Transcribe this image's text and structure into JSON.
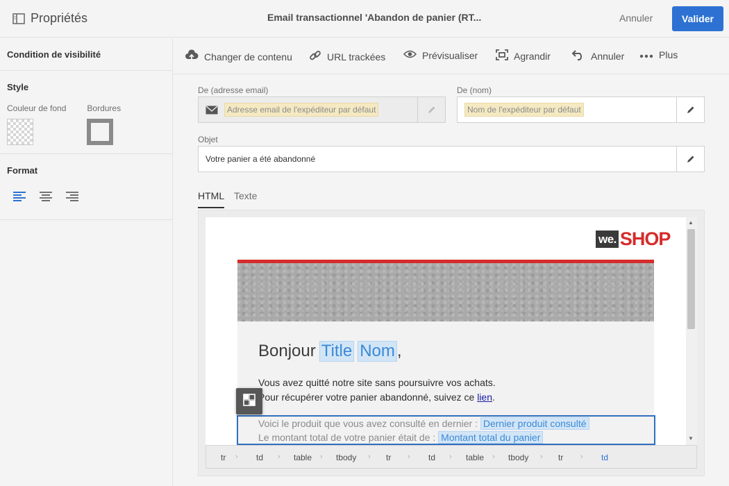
{
  "topbar": {
    "panel_title": "Propriétés",
    "document_title": "Email transactionnel 'Abandon de panier (RT...",
    "cancel_label": "Annuler",
    "validate_label": "Valider"
  },
  "left_panel": {
    "visibility_title": "Condition de visibilité",
    "style_title": "Style",
    "bg_color_label": "Couleur de fond",
    "borders_label": "Bordures",
    "format_title": "Format",
    "format_icons": [
      "align-left-icon",
      "align-center-icon",
      "align-right-icon"
    ]
  },
  "toolbar": {
    "items": [
      {
        "label": "Changer de contenu",
        "icon": "cloud-upload-icon"
      },
      {
        "label": "URL trackées",
        "icon": "link-icon"
      },
      {
        "label": "Prévisualiser",
        "icon": "eye-icon"
      },
      {
        "label": "Agrandir",
        "icon": "expand-icon"
      },
      {
        "label": "Annuler",
        "icon": "undo-icon"
      },
      {
        "label": "Plus",
        "icon": "more-icon"
      }
    ]
  },
  "form": {
    "from_email_label": "De (adresse email)",
    "from_email_placeholder": "Adresse email de l'expéditeur par défaut",
    "from_name_label": "De (nom)",
    "from_name_placeholder": "Nom de l'expéditeur par défaut",
    "subject_label": "Objet",
    "subject_value": "Votre panier a été abandonné"
  },
  "tabs": [
    {
      "label": "HTML",
      "active": true
    },
    {
      "label": "Texte",
      "active": false
    }
  ],
  "email": {
    "logo_we": "we.",
    "logo_shop": "SHOP",
    "greeting": "Bonjour",
    "token_title": "Title",
    "token_name": "Nom",
    "greeting_end": ",",
    "line1": "Vous avez quitté notre site sans poursuivre vos achats.",
    "line2_prefix": "Pour récupérer votre panier abandonné, suivez ce ",
    "line2_link": "lien",
    "line2_suffix": ".",
    "line3_prefix": "Voici le produit que vous avez consulté en dernier : ",
    "token_last_product": "Dernier produit consulté",
    "line4_prefix": "Le montant total de votre panier était de : ",
    "token_cart_total": "Montant total du panier"
  },
  "breadcrumb": [
    "tr",
    "td",
    "table",
    "tbody",
    "tr",
    "td",
    "table",
    "tbody",
    "tr",
    "td"
  ],
  "colors": {
    "accent": "#2d72d2",
    "brand_red": "#d62b2b",
    "token_bg": "#d2e5f7",
    "placeholder_bg": "#f5e9c2"
  }
}
